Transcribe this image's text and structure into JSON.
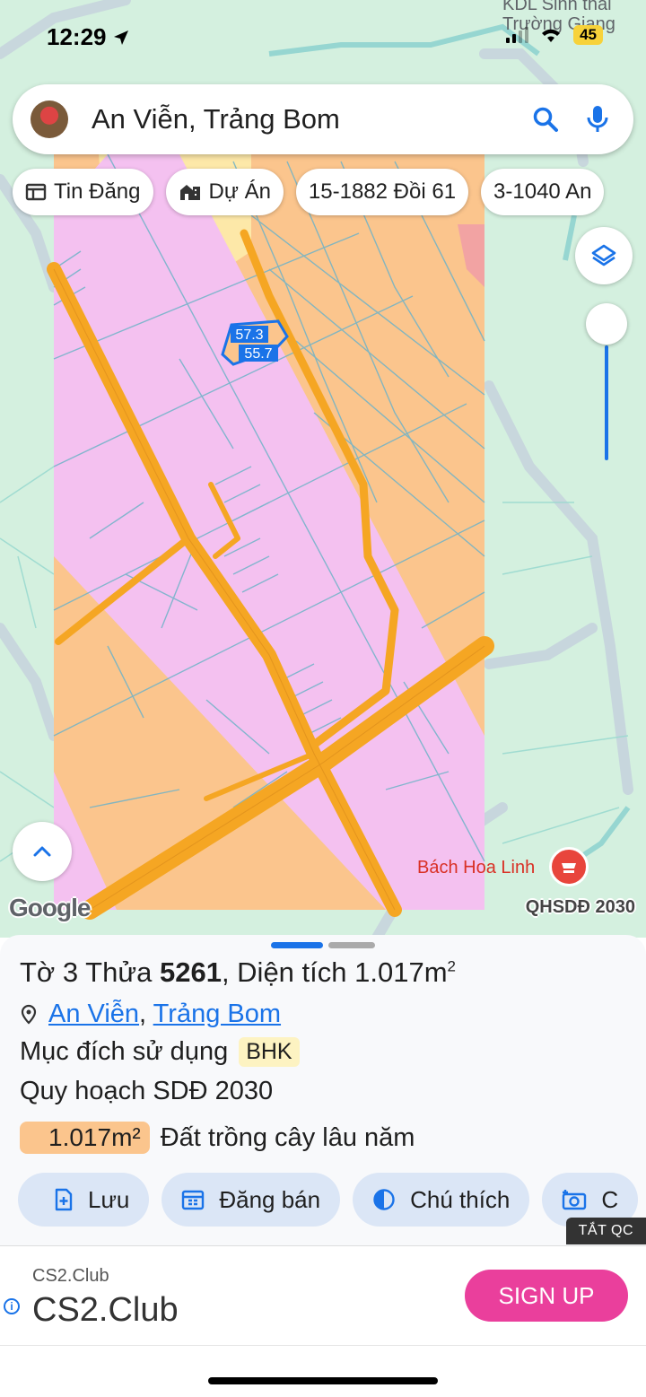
{
  "status_bar": {
    "time": "12:29",
    "battery": "45"
  },
  "map": {
    "poi_top": "KDL Sinh thái Trường Giang",
    "poi_store": "Bách Hoa Linh",
    "parcel_label_1": "57.3",
    "parcel_label_2": "55.7",
    "google_logo": "Google",
    "plan_tag": "QHSDĐ 2030"
  },
  "search": {
    "text": "An Viễn, Trảng Bom",
    "icons": [
      "search-icon",
      "mic-icon"
    ]
  },
  "chips": [
    {
      "label": "Tin Đăng",
      "icon": "listing-icon"
    },
    {
      "label": "Dự Án",
      "icon": "building-icon"
    },
    {
      "label": "15-1882 Đồi 61"
    },
    {
      "label": "3-1040 An"
    }
  ],
  "sheet": {
    "title_prefix": "Tờ 3 Thửa",
    "parcel_no": "5261",
    "title_mid": ", Diện tích",
    "area": "1.017m",
    "area_sup": "2",
    "location_1": "An Viễn",
    "location_sep": ",",
    "location_2": "Trảng Bom",
    "usage_label": "Mục đích sử dụng",
    "usage_code": "BHK",
    "plan_label": "Quy hoạch SDĐ 2030",
    "plan_area": "1.017m²",
    "plan_type": "Đất trồng cây lâu năm",
    "land_color": "#fbc58d"
  },
  "actions": [
    {
      "label": "Lưu",
      "icon": "add-file-icon"
    },
    {
      "label": "Đăng bán",
      "icon": "calendar-icon"
    },
    {
      "label": "Chú thích",
      "icon": "contrast-icon"
    },
    {
      "label": "C",
      "icon": "camera-icon"
    }
  ],
  "ad": {
    "toggle": "TẮT QC",
    "small": "CS2.Club",
    "big": "CS2.Club",
    "button": "SIGN UP",
    "button_color": "#ea3f9c"
  },
  "colors": {
    "map_bg": "#d4f0df",
    "zone_orange": "#fbc58d",
    "zone_pink": "#f4c1f0",
    "road": "#f5a623",
    "accent": "#1a73e8"
  }
}
